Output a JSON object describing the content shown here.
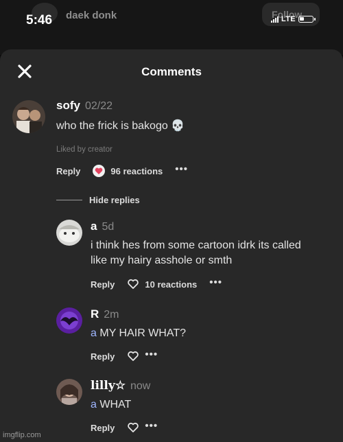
{
  "status_bar": {
    "time": "5:46",
    "network": "LTE"
  },
  "background_post": {
    "username": "daek donk",
    "follow_label": "Follow"
  },
  "sheet": {
    "title": "Comments"
  },
  "comments": [
    {
      "author": "sofy",
      "time": "02/22",
      "text": "who the frick is bakogo",
      "emoji": "💀",
      "liked_by": "Liked by creator",
      "reply_label": "Reply",
      "reactions_label": "96 reactions",
      "more": "•••"
    }
  ],
  "hide_replies_label": "Hide replies",
  "replies": [
    {
      "author": "a",
      "time": "5d",
      "text": "i think hes from some cartoon idrk its called like my hairy asshole or smth",
      "reply_label": "Reply",
      "reactions_label": "10 reactions",
      "more": "•••"
    },
    {
      "author": "R",
      "time": "2m",
      "mention": "a",
      "text": "MY HAIR WHAT?",
      "reply_label": "Reply",
      "more": "•••"
    },
    {
      "author": "lilly☆",
      "time": "now",
      "mention": "a",
      "text": "WHAT",
      "reply_label": "Reply",
      "more": "•••"
    }
  ],
  "watermark": "imgflip.com",
  "icons": {
    "close": "close-icon",
    "heart_filled": "heart-filled-icon",
    "heart_outline": "heart-outline-icon"
  },
  "colors": {
    "sheet_bg": "#282828",
    "heart": "#e2435f",
    "mention": "#9fb6ff"
  }
}
